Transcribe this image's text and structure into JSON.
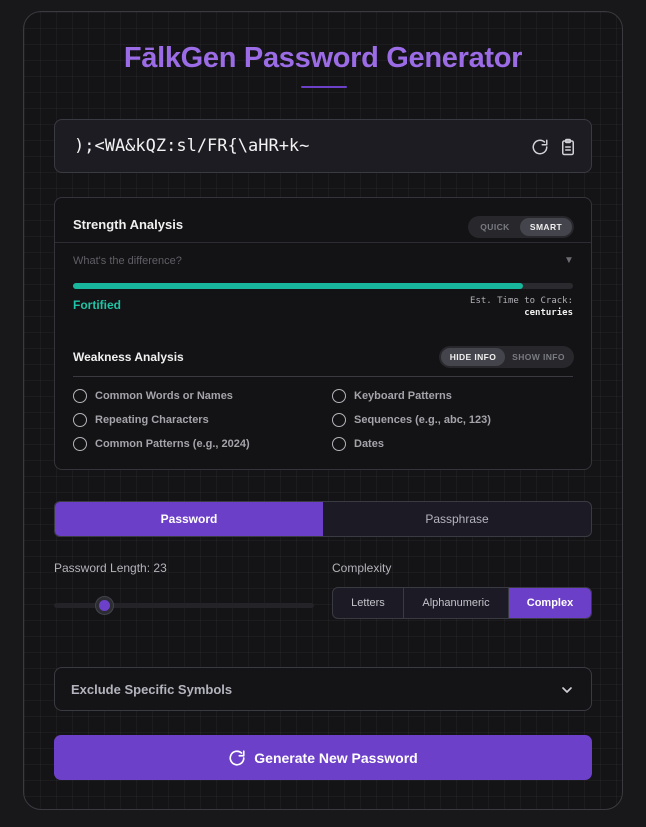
{
  "app": {
    "title": "FālkGen Password Generator"
  },
  "password": {
    "value": ");<WA&kQZ:sl/FR{\\aHR+k~"
  },
  "strength": {
    "title": "Strength Analysis",
    "mode_toggle": {
      "options": [
        "QUICK",
        "SMART"
      ],
      "selected": "SMART"
    },
    "hint": "What's the difference?",
    "score_fraction": 0.9,
    "rating": "Fortified",
    "crack_label": "Est. Time to Crack:",
    "crack_value": "centuries",
    "colors": {
      "bar": "#18b69c",
      "rating": "#1fc4a6"
    }
  },
  "weakness": {
    "title": "Weakness Analysis",
    "info_toggle": {
      "options": [
        "HIDE INFO",
        "SHOW INFO"
      ],
      "selected": "HIDE INFO"
    },
    "left_items": [
      "Common Words or Names",
      "Repeating Characters",
      "Common Patterns (e.g., 2024)"
    ],
    "right_items": [
      "Keyboard Patterns",
      "Sequences (e.g., abc, 123)",
      "Dates"
    ]
  },
  "mode_tabs": {
    "options": [
      "Password",
      "Passphrase"
    ],
    "selected": "Password"
  },
  "length": {
    "label": "Password Length: 23",
    "value": 23
  },
  "complexity": {
    "label": "Complexity",
    "options": [
      "Letters",
      "Alphanumeric",
      "Complex"
    ],
    "selected": "Complex"
  },
  "exclude": {
    "label": "Exclude Specific Symbols"
  },
  "generate": {
    "label": "Generate New Password"
  },
  "theme": {
    "accent": "#6d40c9",
    "title": "#9b6ce6",
    "background": "#18181b"
  }
}
